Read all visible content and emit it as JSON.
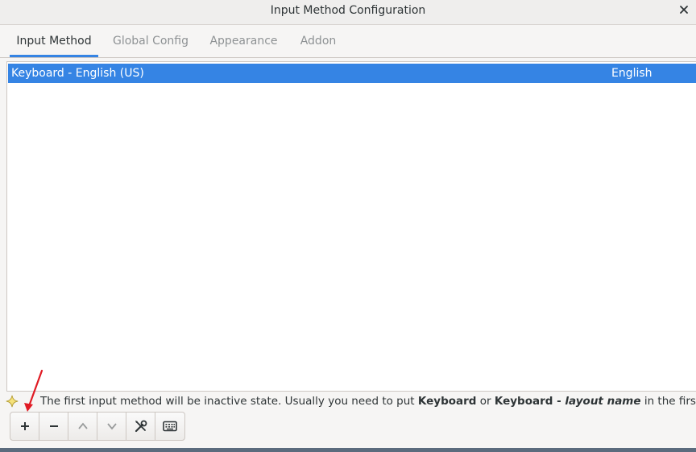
{
  "window": {
    "title": "Input Method Configuration"
  },
  "tabs": [
    {
      "label": "Input Method",
      "active": true
    },
    {
      "label": "Global Config",
      "active": false
    },
    {
      "label": "Appearance",
      "active": false
    },
    {
      "label": "Addon",
      "active": false
    }
  ],
  "input_methods": [
    {
      "name": "Keyboard - English (US)",
      "language": "English",
      "selected": true
    }
  ],
  "hint": {
    "text_1": "The first input method will be inactive state. Usually you need to put ",
    "bold_1": "Keyboard",
    "text_2": " or ",
    "bold_2": "Keyboard - ",
    "italic": "layout name",
    "text_3": " in the first place.",
    "icon": "sparkle-icon"
  },
  "toolbar": [
    {
      "icon": "plus-icon",
      "enabled": true
    },
    {
      "icon": "minus-icon",
      "enabled": true
    },
    {
      "icon": "chevron-up-icon",
      "enabled": false
    },
    {
      "icon": "chevron-down-icon",
      "enabled": false
    },
    {
      "icon": "tools-icon",
      "enabled": true
    },
    {
      "icon": "keyboard-icon",
      "enabled": true
    }
  ],
  "colors": {
    "accent": "#3584e4",
    "annotation_arrow": "#e01b24"
  }
}
